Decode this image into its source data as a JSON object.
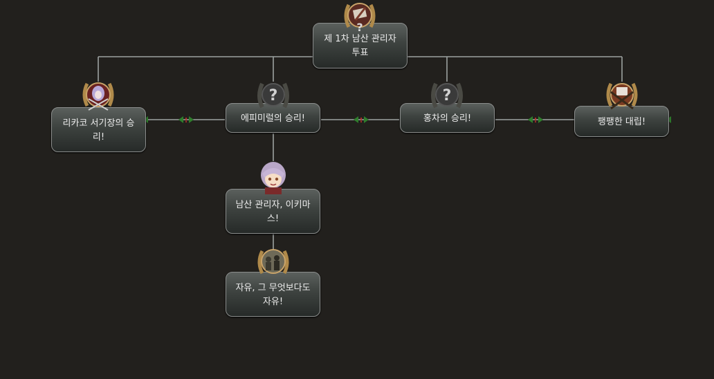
{
  "focus_tree": {
    "nodes": [
      {
        "id": "n1",
        "label": "제 1차 남산 관리자 투표",
        "icon": "quill-document-icon"
      },
      {
        "id": "n2",
        "label": "리카코 서기장의 승리!",
        "icon": "leader-portrait-icon"
      },
      {
        "id": "n3",
        "label": "에피미럴의 승리!",
        "icon": "unknown-question-icon"
      },
      {
        "id": "n4",
        "label": "홍차의 승리!",
        "icon": "unknown-question-icon"
      },
      {
        "id": "n5",
        "label": "팽팽한 대립!",
        "icon": "crossed-weapons-icon"
      },
      {
        "id": "n6",
        "label": "남산 관리자, 이키마스!",
        "icon": "leader-portrait-icon"
      },
      {
        "id": "n7",
        "label": "자유, 그 무엇보다도 자유!",
        "icon": "crowd-scene-icon"
      }
    ],
    "exclusive_marker_text": "!",
    "colors": {
      "background": "#22201d",
      "node_border": "#8b8d8c",
      "line": "#9da2a2",
      "exclusive_arrow": "#2f7d2c",
      "exclusive_mark": "#c0302b",
      "wreath": "#b08a4a",
      "medallion": "#3a3a3a"
    }
  }
}
